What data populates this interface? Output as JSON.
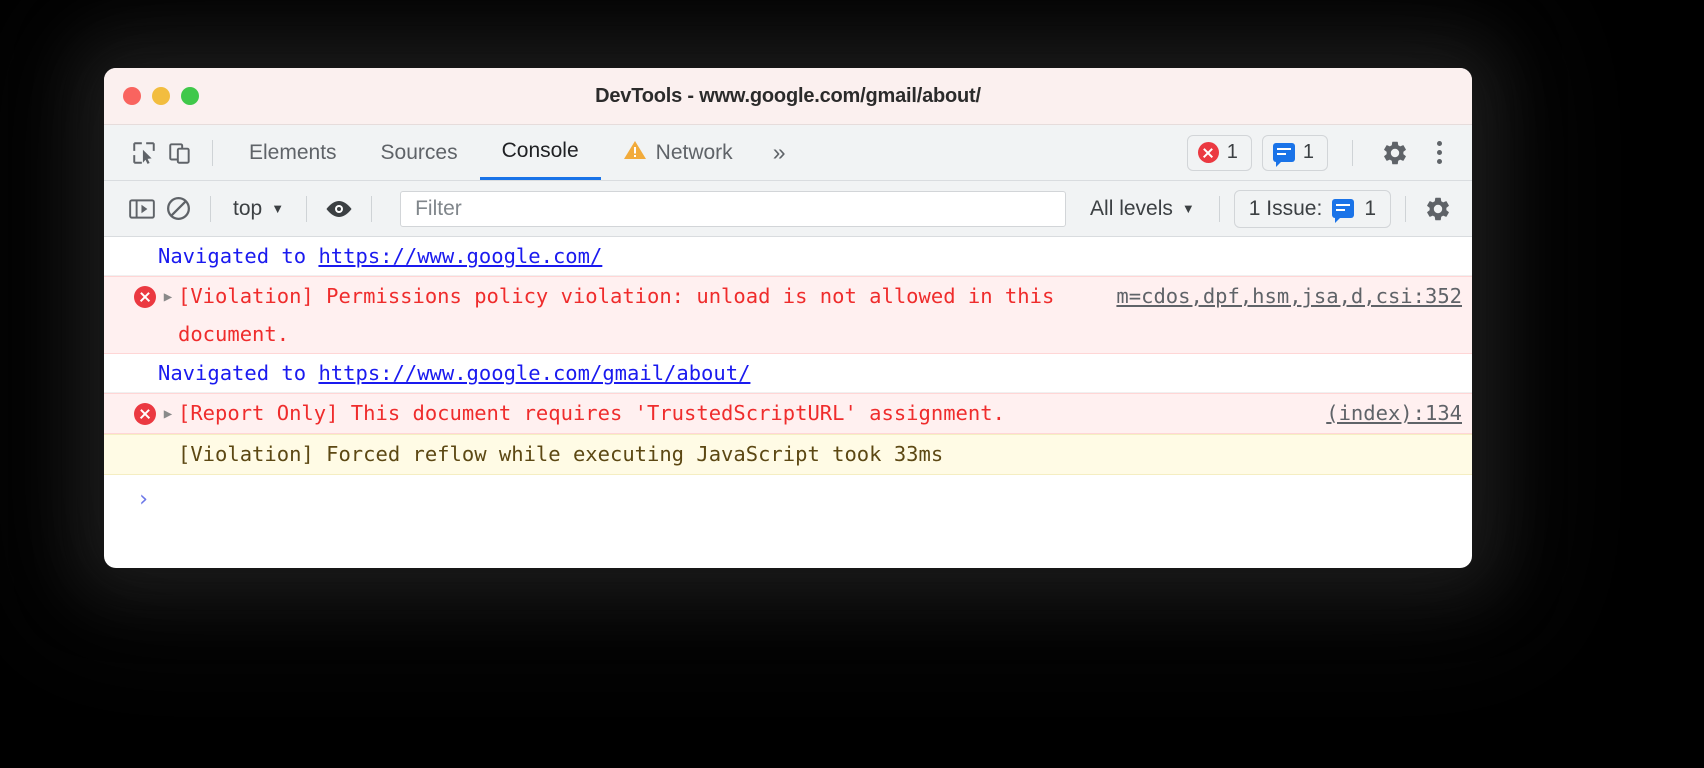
{
  "window": {
    "title": "DevTools - www.google.com/gmail/about/",
    "traffic_lights": [
      "close",
      "minimize",
      "maximize"
    ]
  },
  "tabbar": {
    "inspect_icon": "inspect-cursor-icon",
    "device_icon": "device-toolbar-icon",
    "tabs": [
      {
        "label": "Elements",
        "active": false,
        "warning": false
      },
      {
        "label": "Sources",
        "active": false,
        "warning": false
      },
      {
        "label": "Console",
        "active": true,
        "warning": false
      },
      {
        "label": "Network",
        "active": false,
        "warning": true
      }
    ],
    "more_tabs": "»",
    "error_count": "1",
    "issue_count": "1",
    "settings_icon": "gear-icon",
    "menu_icon": "kebab-menu-icon"
  },
  "console_toolbar": {
    "sidebar_icon": "console-sidebar-icon",
    "clear_icon": "clear-console-icon",
    "context_label": "top",
    "context_caret": "▼",
    "eye_icon": "live-expression-eye-icon",
    "filter_placeholder": "Filter",
    "filter_value": "",
    "levels_label": "All levels",
    "levels_caret": "▼",
    "issues_label": "1 Issue:",
    "issues_count": "1",
    "settings_icon": "console-settings-gear-icon"
  },
  "console": {
    "messages": [
      {
        "type": "info",
        "has_icon": false,
        "has_disclosure": false,
        "text_before_link": "Navigated to ",
        "link_text": "https://www.google.com/",
        "text_after_link": "",
        "source": ""
      },
      {
        "type": "error",
        "has_icon": true,
        "has_disclosure": true,
        "text_before_link": "[Violation] Permissions policy violation: unload is not allowed in this document.",
        "link_text": "",
        "text_after_link": "",
        "source": "m=cdos,dpf,hsm,jsa,d,csi:352"
      },
      {
        "type": "info",
        "has_icon": false,
        "has_disclosure": false,
        "text_before_link": "Navigated to ",
        "link_text": "https://www.google.com/gmail/about/",
        "text_after_link": "",
        "source": ""
      },
      {
        "type": "error",
        "has_icon": true,
        "has_disclosure": true,
        "text_before_link": "[Report Only] This document requires 'TrustedScriptURL' assignment.",
        "link_text": "",
        "text_after_link": "",
        "source": "(index):134"
      },
      {
        "type": "warning",
        "has_icon": false,
        "has_disclosure": false,
        "text_before_link": "[Violation] Forced reflow while executing JavaScript took 33ms",
        "link_text": "",
        "text_after_link": "",
        "source": ""
      }
    ],
    "prompt_caret": "›",
    "prompt_value": ""
  },
  "colors": {
    "accent_blue": "#1a73e8",
    "error_red": "#eb3941",
    "error_text": "#ef2c2c",
    "error_bg": "#fff0f0",
    "warning_bg": "#fffbe5",
    "warning_text": "#5c4813",
    "info_text": "#1a1aef",
    "titlebar_bg": "#fbf0ef",
    "toolbar_bg": "#f1f3f4"
  }
}
